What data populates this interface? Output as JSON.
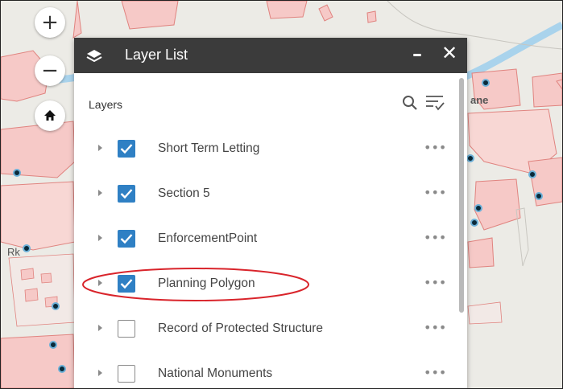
{
  "map_controls": {
    "zoom_in_label": "+",
    "zoom_out_label": "−",
    "home_icon": "home-icon"
  },
  "layer_list": {
    "title": "Layer List",
    "minimize_label": "–",
    "close_label": "✕",
    "section_label": "Layers",
    "search_icon": "search-icon",
    "filter_icon": "filter-list-icon",
    "layers": [
      {
        "label": "Short Term Letting",
        "checked": true,
        "more": "•••"
      },
      {
        "label": "Section 5",
        "checked": true,
        "more": "•••"
      },
      {
        "label": "EnforcementPoint",
        "checked": true,
        "more": "•••"
      },
      {
        "label": "Planning Polygon",
        "checked": true,
        "more": "•••",
        "highlighted": true
      },
      {
        "label": "Record of Protected Structure",
        "checked": false,
        "more": "•••"
      },
      {
        "label": "National Monuments",
        "checked": false,
        "more": "•••"
      }
    ]
  },
  "map_labels": {
    "town_fragment_left": "Rk",
    "town_fragment_right": "ane"
  },
  "colors": {
    "header_bg": "#3b3b3b",
    "checkbox_accent": "#2f80c4",
    "highlight_ellipse": "#d9242b",
    "parcel_fill": "#f6c9c7",
    "parcel_stroke": "#e0837f",
    "river": "#a9d3ec"
  }
}
